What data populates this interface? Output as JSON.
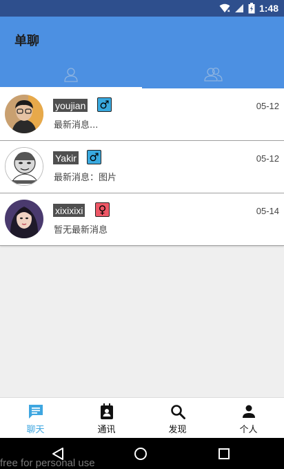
{
  "status": {
    "time": "1:48"
  },
  "app": {
    "title": "单聊"
  },
  "tabs": [
    {
      "icon": "single-user-icon",
      "active": true
    },
    {
      "icon": "group-users-icon",
      "active": false
    }
  ],
  "conversations": [
    {
      "name": "youjian",
      "gender": "male",
      "gender_symbol": "♂",
      "message": "最新消息...",
      "date": "05-12"
    },
    {
      "name": "Yakir",
      "gender": "male",
      "gender_symbol": "♂",
      "message": "最新消息：图片",
      "date": "05-12"
    },
    {
      "name": "xixixixi",
      "gender": "female",
      "gender_symbol": "♀",
      "message": "暂无最新消息",
      "date": "05-14"
    }
  ],
  "bottom_nav": [
    {
      "label": "聊天",
      "icon": "chat-icon",
      "active": true
    },
    {
      "label": "通讯",
      "icon": "contacts-icon",
      "active": false
    },
    {
      "label": "发现",
      "icon": "search-icon",
      "active": false
    },
    {
      "label": "个人",
      "icon": "person-icon",
      "active": false
    }
  ],
  "watermark": "free for personal use",
  "colors": {
    "status_bar": "#2e4f8d",
    "app_bar": "#4c90e2",
    "male": "#39a9df",
    "female": "#ee5766",
    "active_nav": "#3ea6e0"
  }
}
